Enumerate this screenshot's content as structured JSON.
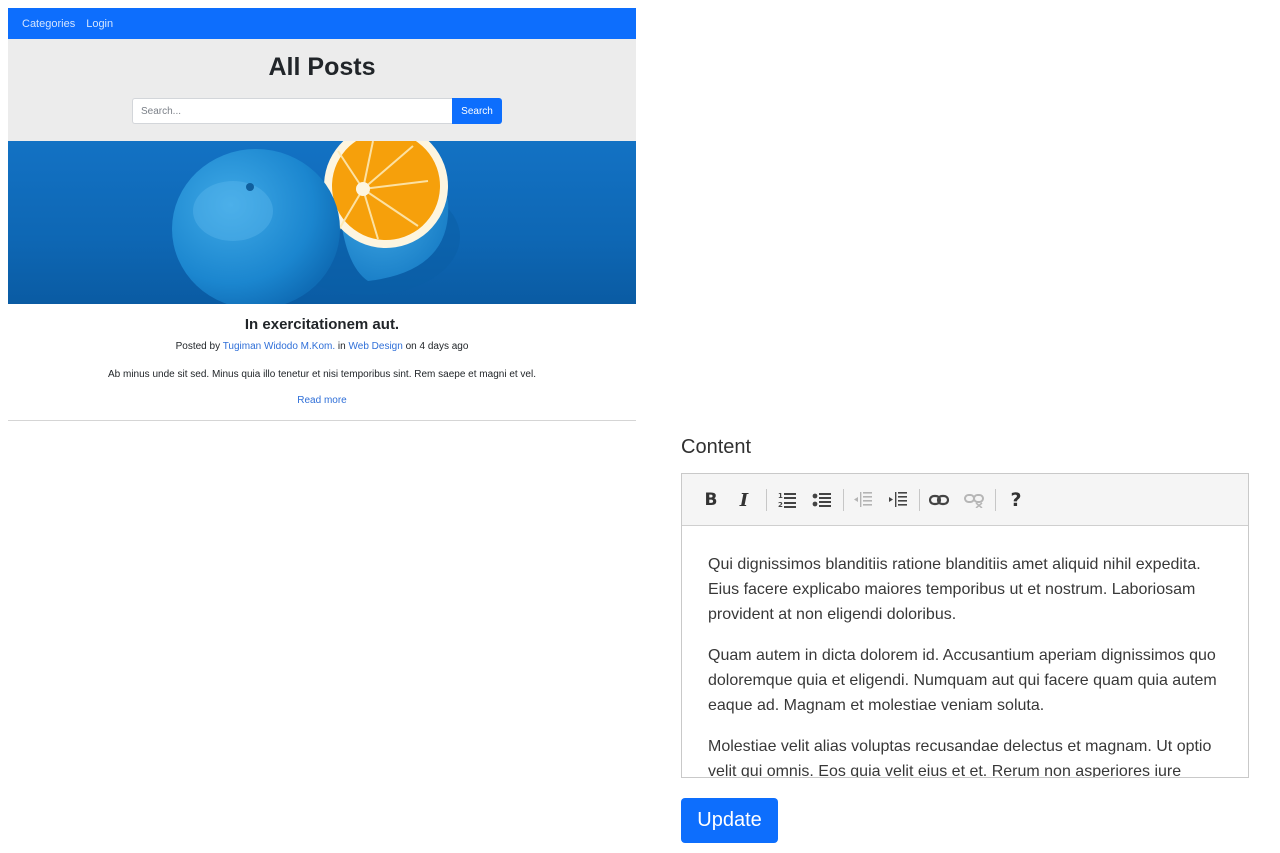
{
  "nav": {
    "items": [
      {
        "label": "Categories"
      },
      {
        "label": "Login"
      }
    ]
  },
  "hero": {
    "title": "All Posts",
    "search_placeholder": "Search...",
    "search_button": "Search"
  },
  "post": {
    "title": "In exercitationem aut.",
    "meta_posted_by": "Posted by",
    "meta_author": "Tugiman Widodo M.Kom.",
    "meta_in": "in",
    "meta_category": "Web Design",
    "meta_on": "on 4 days ago",
    "excerpt": "Ab minus unde sit sed. Minus quia illo tenetur et nisi temporibus sint. Rem saepe et magni et vel.",
    "read_more": "Read more",
    "image_subject": "orange-on-blue-image"
  },
  "editor": {
    "label": "Content",
    "toolbar": [
      {
        "name": "bold",
        "glyph": "B"
      },
      {
        "name": "italic",
        "glyph": "I"
      },
      {
        "name": "numbered-list",
        "icon": "numbered-list-icon"
      },
      {
        "name": "bulleted-list",
        "icon": "bulleted-list-icon"
      },
      {
        "name": "outdent",
        "icon": "outdent-icon",
        "disabled": true
      },
      {
        "name": "indent",
        "icon": "indent-icon"
      },
      {
        "name": "link",
        "icon": "link-icon"
      },
      {
        "name": "unlink",
        "icon": "unlink-icon",
        "disabled": true
      },
      {
        "name": "help",
        "glyph": "?"
      }
    ],
    "paragraphs": [
      "Qui dignissimos blanditiis ratione blanditiis amet aliquid nihil expedita. Eius facere explicabo maiores temporibus ut et nostrum. Laboriosam provident at non eligendi doloribus.",
      "Quam autem in dicta dolorem id. Accusantium aperiam dignissimos quo doloremque quia et eligendi. Numquam aut qui facere quam quia autem eaque ad. Magnam et molestiae veniam soluta.",
      "Molestiae velit alias voluptas recusandae delectus et magnam. Ut optio velit qui omnis. Eos quia velit eius et et. Rerum non asperiores iure"
    ]
  },
  "actions": {
    "update": "Update"
  },
  "colors": {
    "primary": "#0d6efd",
    "hero_bg": "#ececec",
    "link": "#2f6fd8",
    "image_bg": "#1372c4",
    "orange": "#f6a00b"
  }
}
